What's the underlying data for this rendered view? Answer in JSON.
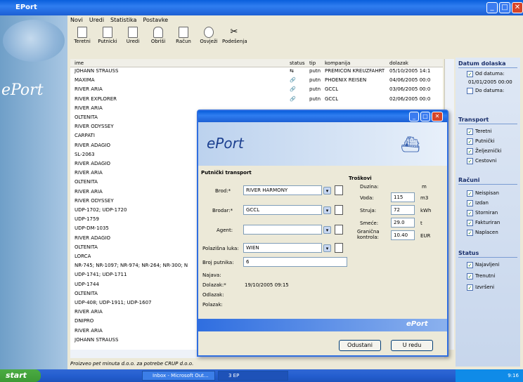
{
  "window": {
    "title": "EPort"
  },
  "brand": {
    "logo": "ePort"
  },
  "menu": [
    "Novi",
    "Uredi",
    "Statistika",
    "Postavke"
  ],
  "toolbar": [
    "Teretni",
    "Putnicki",
    "Uredi",
    "Obriši",
    "Račun",
    "Osvježi",
    "Podešenja"
  ],
  "list": {
    "headers": {
      "name": "ime",
      "status": "status",
      "tip": "tip",
      "kompanija": "kompanija",
      "dolazak": "dolazak"
    },
    "rows": [
      {
        "name": "JOHANN STRAUSS",
        "status": "⇆",
        "tip": "putn",
        "kompanija": "PREMICON KREUZFAHRT",
        "dolazak": "05/10/2005 14:1"
      },
      {
        "name": "MAXIMA",
        "status": "🔗",
        "tip": "putn",
        "kompanija": "PHOENIX REISEN",
        "dolazak": "04/06/2005 00:0"
      },
      {
        "name": "RIVER ARIA",
        "status": "🔗",
        "tip": "putn",
        "kompanija": "GCCL",
        "dolazak": "03/06/2005 00:0"
      },
      {
        "name": "RIVER EXPLORER",
        "status": "🔗",
        "tip": "putn",
        "kompanija": "GCCL",
        "dolazak": "02/06/2005 00:0"
      },
      {
        "name": "RIVER ARIA"
      },
      {
        "name": "OLTENITA"
      },
      {
        "name": "RIVER ODYSSEY"
      },
      {
        "name": "CARPATI"
      },
      {
        "name": "RIVER ADAGIO"
      },
      {
        "name": "SL-2063"
      },
      {
        "name": "RIVER ADAGIO"
      },
      {
        "name": "RIVER ARIA"
      },
      {
        "name": "OLTENITA"
      },
      {
        "name": "RIVER ARIA"
      },
      {
        "name": "RIVER ODYSSEY"
      },
      {
        "name": "UDP-1702; UDP-1720"
      },
      {
        "name": "UDP-1759"
      },
      {
        "name": "UDP-DM-1035"
      },
      {
        "name": "RIVER ADAGIO"
      },
      {
        "name": "OLTENITA"
      },
      {
        "name": "LORCA"
      },
      {
        "name": "NR-745; NR-1097; NR-974; NR-264; NR-300; N"
      },
      {
        "name": "UDP-1741; UDP-1711"
      },
      {
        "name": "UDP-1744"
      },
      {
        "name": "OLTENITA"
      },
      {
        "name": "UDP-408; UDP-1911; UDP-1607"
      },
      {
        "name": "RIVER ARIA"
      },
      {
        "name": "DNIPRO"
      },
      {
        "name": "RIVER ARIA"
      },
      {
        "name": "JOHANN STRAUSS"
      }
    ]
  },
  "statusbar": {
    "text": "Proizveo pet minuta d.o.o. za potrebe CRUP d.o.o."
  },
  "filters": {
    "datum": {
      "title": "Datum dolaska",
      "od": "Od datuma:",
      "od_value": "01/01/2005 00:00",
      "do": "Do datuma:"
    },
    "transport": {
      "title": "Transport",
      "items": [
        "Teretni",
        "Putnički",
        "Željeznički",
        "Cestovni"
      ]
    },
    "racuni": {
      "title": "Računi",
      "items": [
        "Neispisan",
        "Izdan",
        "Storniran",
        "Fakturiran",
        "Naplacen"
      ]
    },
    "status": {
      "title": "Status",
      "items": [
        "Najavljeni",
        "Trenutni",
        "Izvršeni"
      ]
    }
  },
  "dialog": {
    "brand": "ePort",
    "section": "Putnički transport",
    "fields": {
      "brod_label": "Brod:*",
      "brod_value": "RIVER HARMONY",
      "brodar_label": "Brodar:*",
      "brodar_value": "GCCL",
      "agent_label": "Agent:",
      "agent_value": "",
      "luka_label": "Polazišna luka:",
      "luka_value": "WIEN",
      "putnika_label": "Broj putnika:",
      "putnika_value": "6",
      "najava_label": "Najava:",
      "dolazak_label": "Dolazak:*",
      "dolazak_value": "19/10/2005 09:15",
      "odlazak_label": "Odlazak:",
      "polazak_label": "Polazak:"
    },
    "costs": {
      "title": "Troškovi",
      "duzina_label": "Duzina:",
      "duzina_unit": "m",
      "voda_label": "Voda:",
      "voda_value": "115",
      "voda_unit": "m3",
      "struja_label": "Struja:",
      "struja_value": "72",
      "struja_unit": "kWh",
      "smece_label": "Smeće:",
      "smece_value": "29.0",
      "smece_unit": "t",
      "granicna_label": "Granična kontrola:",
      "granicna_value": "10.40",
      "granicna_unit": "EUR"
    },
    "footer_brand": "ePort",
    "cancel": "Odustani",
    "ok": "U redu"
  },
  "taskbar": {
    "start": "start",
    "tasks": [
      "Inbox - Microsoft Out...",
      "3 EP"
    ],
    "clock": "9:16"
  }
}
